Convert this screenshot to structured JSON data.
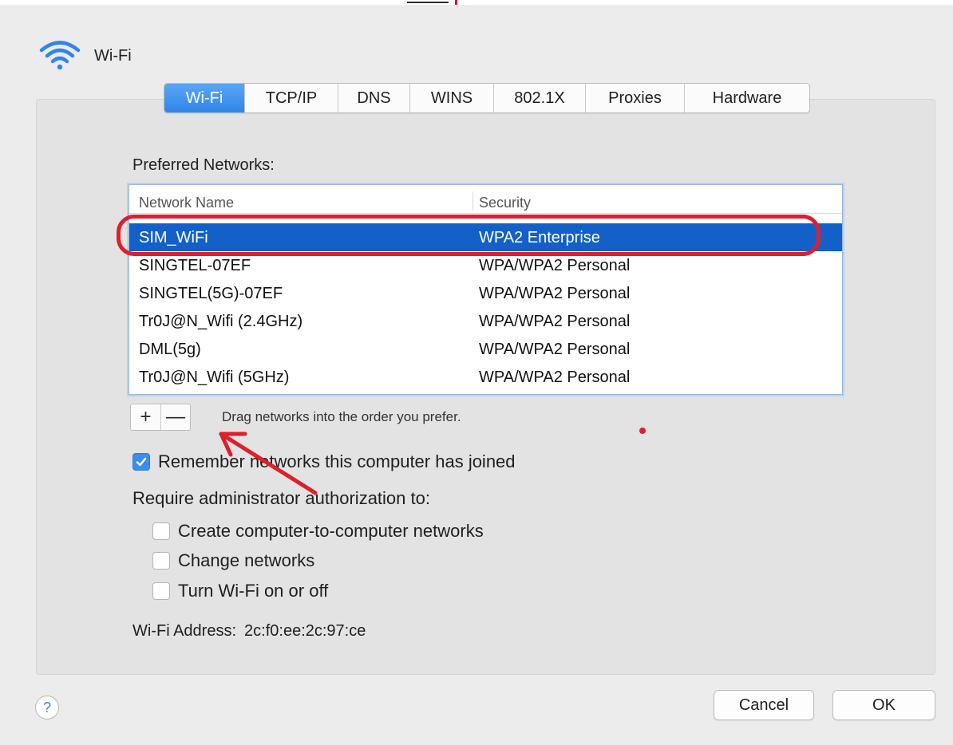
{
  "header": {
    "title": "Wi-Fi",
    "icon": "wifi-icon"
  },
  "tabs": [
    {
      "label": "Wi-Fi",
      "active": true
    },
    {
      "label": "TCP/IP",
      "active": false
    },
    {
      "label": "DNS",
      "active": false
    },
    {
      "label": "WINS",
      "active": false
    },
    {
      "label": "802.1X",
      "active": false
    },
    {
      "label": "Proxies",
      "active": false
    },
    {
      "label": "Hardware",
      "active": false
    }
  ],
  "preferred": {
    "label": "Preferred Networks:",
    "columns": [
      "Network Name",
      "Security"
    ],
    "rows": [
      {
        "name": "SIM_WiFi",
        "security": "WPA2 Enterprise",
        "selected": true
      },
      {
        "name": "SINGTEL-07EF",
        "security": "WPA/WPA2 Personal",
        "selected": false
      },
      {
        "name": "SINGTEL(5G)-07EF",
        "security": "WPA/WPA2 Personal",
        "selected": false
      },
      {
        "name": "Tr0J@N_Wifi (2.4GHz)",
        "security": "WPA/WPA2 Personal",
        "selected": false
      },
      {
        "name": "DML(5g)",
        "security": "WPA/WPA2 Personal",
        "selected": false
      },
      {
        "name": "Tr0J@N_Wifi (5GHz)",
        "security": "WPA/WPA2 Personal",
        "selected": false
      }
    ]
  },
  "list_controls": {
    "add": "+",
    "remove": "—",
    "hint": "Drag networks into the order you prefer."
  },
  "remember": {
    "label": "Remember networks this computer has joined",
    "checked": true
  },
  "require": {
    "label": "Require administrator authorization to:",
    "options": [
      {
        "label": "Create computer-to-computer networks",
        "checked": false
      },
      {
        "label": "Change networks",
        "checked": false
      },
      {
        "label": "Turn Wi-Fi on or off",
        "checked": false
      }
    ]
  },
  "address": {
    "label": "Wi-Fi Address:",
    "value": "2c:f0:ee:2c:97:ce"
  },
  "footer": {
    "help": "?",
    "cancel": "Cancel",
    "ok": "OK"
  },
  "colors": {
    "accent": "#2f86ea",
    "selection": "#1361c8",
    "annotation": "#de1f2d"
  }
}
